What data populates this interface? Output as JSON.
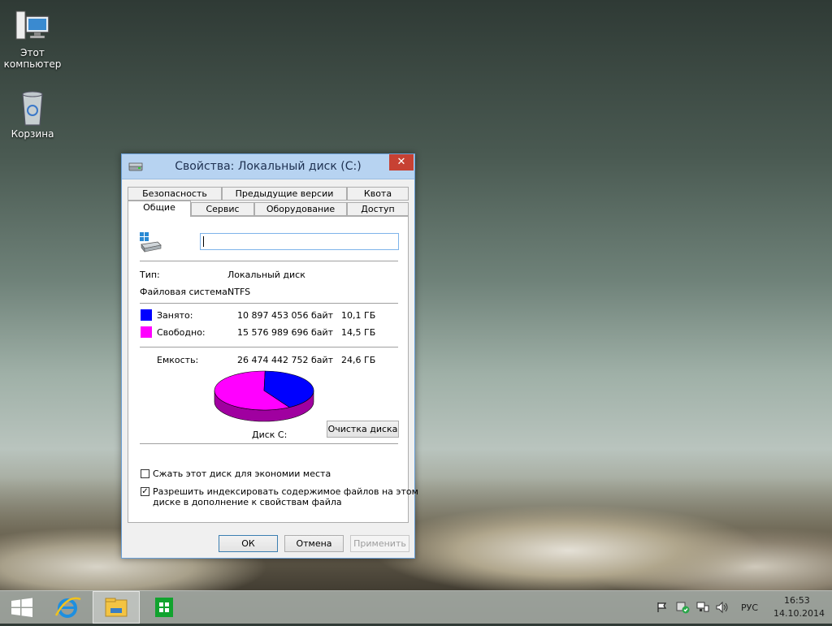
{
  "desktop": {
    "icons": [
      {
        "label_line1": "Этот",
        "label_line2": "компьютер"
      },
      {
        "label_line1": "Корзина"
      }
    ]
  },
  "window": {
    "title": "Свойства: Локальный диск (C:)",
    "close_glyph": "✕",
    "tabs_row1": [
      "Безопасность",
      "Предыдущие версии",
      "Квота"
    ],
    "tabs_row2": [
      "Общие",
      "Сервис",
      "Оборудование",
      "Доступ"
    ],
    "active_tab": "Общие",
    "name_input_value": "",
    "type_label": "Тип:",
    "type_value": "Локальный диск",
    "fs_label": "Файловая система:",
    "fs_value": "NTFS",
    "used_label": "Занято:",
    "used_bytes": "10 897 453 056 байт",
    "used_gb": "10,1 ГБ",
    "free_label": "Свободно:",
    "free_bytes": "15 576 989 696 байт",
    "free_gb": "14,5 ГБ",
    "capacity_label": "Емкость:",
    "capacity_bytes": "26 474 442 752 байт",
    "capacity_gb": "24,6 ГБ",
    "disk_label": "Диск C:",
    "cleanup_button": "Очистка диска",
    "compress_label": "Сжать этот диск для экономии места",
    "compress_checked": false,
    "index_label_line1": "Разрешить индексировать содержимое файлов на этом",
    "index_label_line2": "диске в дополнение к свойствам файла",
    "index_checked": true,
    "ok_button": "ОК",
    "cancel_button": "Отмена",
    "apply_button": "Применить",
    "colors": {
      "used": "#0000ff",
      "free": "#ff00ff"
    },
    "used_fraction": 0.4116
  },
  "taskbar": {
    "language": "РУС",
    "time": "16:53",
    "date": "14.10.2014"
  }
}
